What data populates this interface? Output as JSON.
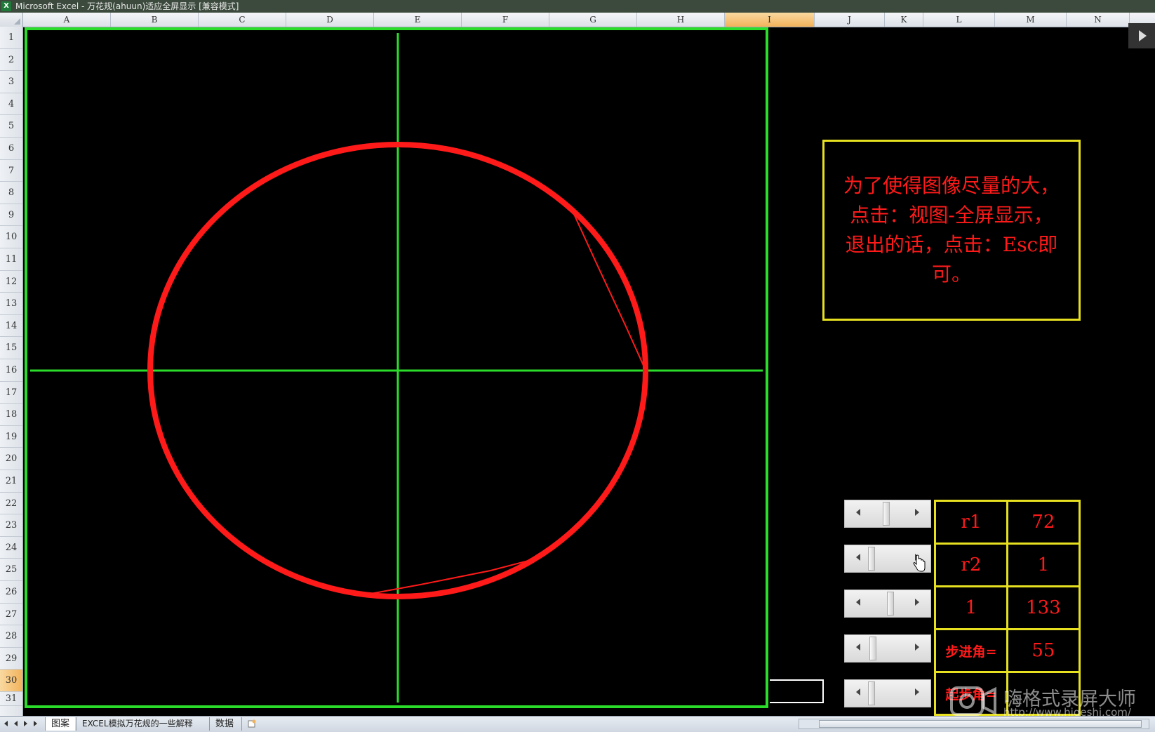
{
  "window": {
    "title": "Microsoft Excel - 万花规(ahuun)适应全屏显示 [兼容模式]"
  },
  "columns": {
    "headers": [
      "A",
      "B",
      "C",
      "D",
      "E",
      "F",
      "G",
      "H",
      "I",
      "J",
      "K",
      "L",
      "M",
      "N"
    ],
    "selected": "I"
  },
  "rows": {
    "headers": [
      "1",
      "2",
      "3",
      "4",
      "5",
      "6",
      "7",
      "8",
      "9",
      "10",
      "11",
      "12",
      "13",
      "14",
      "15",
      "16",
      "17",
      "18",
      "19",
      "20",
      "21",
      "22",
      "23",
      "24",
      "25",
      "26",
      "27",
      "28",
      "29",
      "30",
      "31"
    ],
    "selected": "30"
  },
  "info_box": {
    "lines": [
      "为了使得图像尽量的大，",
      "点击：视图-全屏显示，",
      "退出的话，点击：Esc即",
      "可。"
    ]
  },
  "params": {
    "rows": [
      {
        "label": "r1",
        "value": "72"
      },
      {
        "label": "r2",
        "value": "1"
      },
      {
        "label": "1",
        "value": "133"
      },
      {
        "label": "步进角=",
        "value": "55"
      },
      {
        "label": "起步角=",
        "value": ""
      }
    ]
  },
  "sliders": [
    {
      "name": "r1-slider",
      "level": 0.45
    },
    {
      "name": "r2-slider",
      "level": 0.05
    },
    {
      "name": "param3-slider",
      "level": 0.55
    },
    {
      "name": "step-angle-slider",
      "level": 0.1
    },
    {
      "name": "start-angle-slider",
      "level": 0.05
    }
  ],
  "sheet_tabs": {
    "tabs": [
      "图案",
      "EXCEL模拟万花规的一些解释",
      "数据"
    ],
    "active": "图案"
  },
  "watermark": {
    "text": "嗨格式录屏大师",
    "url": "http://www.higeshi.com/"
  },
  "colors": {
    "frame": "#2bdd2b",
    "curve": "#ff1a1a",
    "box_border": "#e6e020",
    "selected_header": "#f2b25a"
  }
}
